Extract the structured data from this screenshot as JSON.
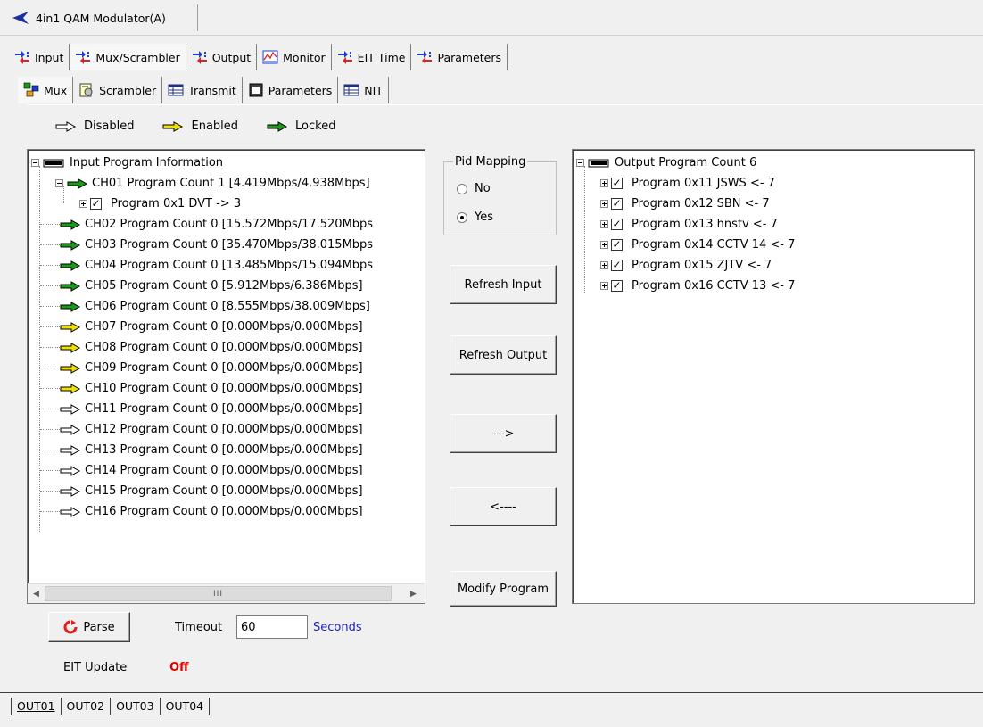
{
  "window": {
    "title": "4in1 QAM Modulator(A)"
  },
  "main_tabs": [
    {
      "label": "Input"
    },
    {
      "label": "Mux/Scrambler"
    },
    {
      "label": "Output"
    },
    {
      "label": "Monitor"
    },
    {
      "label": "EIT Time"
    },
    {
      "label": "Parameters"
    }
  ],
  "sub_tabs": [
    {
      "label": "Mux"
    },
    {
      "label": "Scrambler"
    },
    {
      "label": "Transmit"
    },
    {
      "label": "Parameters"
    },
    {
      "label": "NIT"
    }
  ],
  "legend": {
    "disabled": "Disabled",
    "enabled": "Enabled",
    "locked": "Locked"
  },
  "colors": {
    "locked": "#1a9a1a",
    "enabled": "#f0e000",
    "disabled": "#ffffff",
    "parse_icon": "#e02020",
    "off": "#e00000",
    "seconds": "#2020c0"
  },
  "input_tree": {
    "root": "Input Program Information",
    "ch01": "CH01 Program Count 1 [4.419Mbps/4.938Mbps]",
    "ch01_child": "Program 0x1 DVT -> 3",
    "channels": [
      "CH02 Program Count 0 [15.572Mbps/17.520Mbps",
      "CH03 Program Count 0 [35.470Mbps/38.015Mbps",
      "CH04 Program Count 0 [13.485Mbps/15.094Mbps",
      "CH05 Program Count 0 [5.912Mbps/6.386Mbps]",
      "CH06 Program Count 0 [8.555Mbps/38.009Mbps]",
      "CH07 Program Count 0 [0.000Mbps/0.000Mbps]",
      "CH08 Program Count 0 [0.000Mbps/0.000Mbps]",
      "CH09 Program Count 0 [0.000Mbps/0.000Mbps]",
      "CH10 Program Count 0 [0.000Mbps/0.000Mbps]",
      "CH11 Program Count 0 [0.000Mbps/0.000Mbps]",
      "CH12 Program Count 0 [0.000Mbps/0.000Mbps]",
      "CH13 Program Count 0 [0.000Mbps/0.000Mbps]",
      "CH14 Program Count 0 [0.000Mbps/0.000Mbps]",
      "CH15 Program Count 0 [0.000Mbps/0.000Mbps]",
      "CH16 Program Count 0 [0.000Mbps/0.000Mbps]"
    ],
    "channel_states": [
      "locked",
      "locked",
      "locked",
      "locked",
      "locked",
      "enabled",
      "enabled",
      "enabled",
      "enabled",
      "disabled",
      "disabled",
      "disabled",
      "disabled",
      "disabled",
      "disabled"
    ]
  },
  "pid_mapping": {
    "title": "Pid Mapping",
    "no": "No",
    "yes": "Yes",
    "selected": "Yes"
  },
  "buttons": {
    "refresh_input": "Refresh Input",
    "refresh_output": "Refresh Output",
    "add": "--->",
    "remove": "<----",
    "modify": "Modify Program",
    "parse": "Parse"
  },
  "output_tree": {
    "root": "Output Program Count 6",
    "programs": [
      "Program 0x11 JSWS <- 7",
      "Program 0x12 SBN <- 7",
      "Program 0x13 hnstv <- 7",
      "Program 0x14 CCTV 14 <- 7",
      "Program 0x15 ZJTV <- 7",
      "Program 0x16 CCTV 13 <- 7"
    ]
  },
  "timeout": {
    "label": "Timeout",
    "value": "60",
    "unit": "Seconds"
  },
  "eit": {
    "label": "EIT Update",
    "value": "Off"
  },
  "scrollbar": {
    "grip": "III"
  },
  "out_tabs": [
    "OUT01",
    "OUT02",
    "OUT03",
    "OUT04"
  ]
}
